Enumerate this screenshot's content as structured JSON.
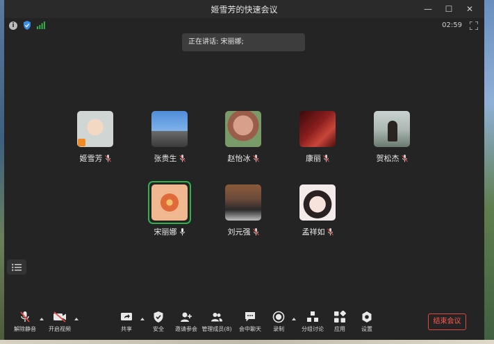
{
  "window": {
    "title": "姬雪芳的快速会议"
  },
  "window_controls": {
    "minimize": "—",
    "maximize": "☐",
    "close": "✕"
  },
  "status": {
    "timer": "02:59",
    "signal_color": "#2fb34a",
    "shield_color": "#3a8ee6"
  },
  "speaking": {
    "text": "正在讲话: 宋丽娜;"
  },
  "participants": [
    {
      "name": "姬雪芳",
      "host": true,
      "active": false,
      "mic": "muted",
      "avatar": "child-photo-icon",
      "color": "#d9dcd8"
    },
    {
      "name": "张贵生",
      "host": false,
      "active": false,
      "mic": "muted",
      "avatar": "sky-person-photo-icon",
      "color": "#4f8cd8"
    },
    {
      "name": "赵怡冰",
      "host": false,
      "active": false,
      "mic": "muted",
      "avatar": "bear-photo-icon",
      "color": "#c68a78"
    },
    {
      "name": "康丽",
      "host": false,
      "active": false,
      "mic": "muted",
      "avatar": "red-portrait-photo-icon",
      "color": "#8a1e1e"
    },
    {
      "name": "贺松杰",
      "host": false,
      "active": false,
      "mic": "muted",
      "avatar": "lakeside-photo-icon",
      "color": "#aeb8b4"
    },
    {
      "name": "宋丽娜",
      "host": false,
      "active": true,
      "mic": "on",
      "avatar": "flower-photo-icon",
      "color": "#e0a070"
    },
    {
      "name": "刘元强",
      "host": false,
      "active": false,
      "mic": "muted",
      "avatar": "man-laptop-photo-icon",
      "color": "#6a4a3a"
    },
    {
      "name": "孟祥如",
      "host": false,
      "active": false,
      "mic": "muted",
      "avatar": "girl-portrait-photo-icon",
      "color": "#f2e4e4"
    }
  ],
  "toolbar": {
    "unmute": "解除静音",
    "start_video": "开启视频",
    "share": "共享",
    "security": "安全",
    "invite": "邀请参会",
    "participants": "管理成员(8)",
    "chat": "会中聊天",
    "record": "录制",
    "breakout": "分组讨论",
    "apps": "应用",
    "settings": "设置",
    "end": "结束会议"
  },
  "colors": {
    "accent_green": "#2fb34a",
    "end_red": "#ff5a4e",
    "muted_red": "#e0483e"
  }
}
